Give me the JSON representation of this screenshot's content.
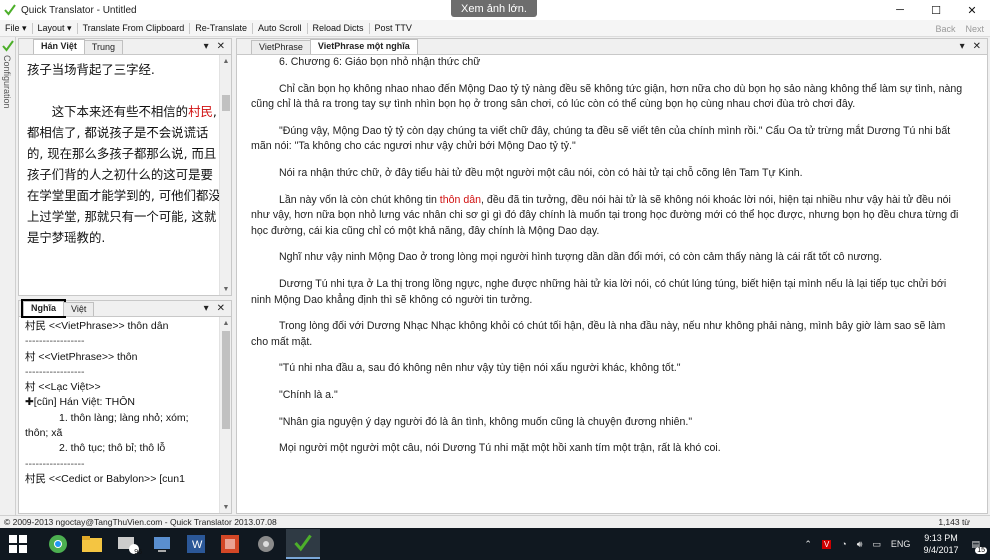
{
  "window": {
    "title": "Quick Translator - Untitled",
    "overlay_badge": "Xem ảnh lớn.",
    "controls": {
      "minimize": "─",
      "maximize": "☐",
      "close": "✕"
    }
  },
  "menu": {
    "items": [
      "File ▾",
      "Layout ▾",
      "Translate From Clipboard",
      "Re-Translate",
      "Auto Scroll",
      "Reload Dicts",
      "Post TTV"
    ],
    "back": "Back",
    "next": "Next"
  },
  "left_strip": {
    "label": "Configuration"
  },
  "chinese_panel": {
    "tabs": [
      "Hán Việt",
      "Trung"
    ],
    "paragraphs": [
      {
        "parts": [
          {
            "text": "孩子当场背起了三字经."
          }
        ]
      },
      {
        "parts": [
          {
            "text": "　　这下本来还有些不相信的"
          },
          {
            "text": "村民",
            "red": true
          },
          {
            "text": ", 都相信了, 都说孩子是不会说谎话的, 现在那么多孩子都那么说, 而且孩子们背的人之初什么的这可是要在学堂里面才能学到的, 可他们都没上过学堂, 那就只有一个可能, 这就是宁梦瑶教的."
          }
        ]
      }
    ]
  },
  "meaning_panel": {
    "tabs": [
      "Nghĩa",
      "Việt"
    ],
    "lines": [
      {
        "text": "村民 <<VietPhrase>> thôn dân"
      },
      {
        "text": "-----------------",
        "dash": true
      },
      {
        "text": "村 <<VietPhrase>> thôn"
      },
      {
        "text": "-----------------",
        "dash": true
      },
      {
        "text": "村 <<Lạc Việt>>"
      },
      {
        "text": "✚[cũn] Hán Việt: THÔN"
      },
      {
        "text": "1. thôn làng; làng nhỏ; xóm;",
        "indent": true
      },
      {
        "text": "thôn; xã"
      },
      {
        "text": "2. thô tục; thô bỉ; thô lỗ",
        "indent": true
      },
      {
        "text": "-----------------",
        "dash": true
      },
      {
        "text": "村民 <<Cedict or Babylon>>  [cun1"
      }
    ]
  },
  "vietphrase_panel": {
    "tabs": [
      "VietPhrase",
      "VietPhrase một nghĩa"
    ],
    "paragraphs": [
      {
        "parts": [
          {
            "text": "6. Chương 6: Giáo bọn nhỏ nhận thức chữ"
          }
        ]
      },
      {
        "parts": [
          {
            "text": "Chỉ cần bọn họ không nhao nhao đến Mộng Dao tỷ tỷ nàng đều sẽ không tức giận, hơn nữa cho dù bọn họ sảo nàng không thể làm sự tình, nàng cũng chỉ là thả ra trong tay sự tình nhìn bọn họ ở trong sân chơi, có lúc còn có thể cùng bọn họ cùng nhau chơi đùa trò chơi đây."
          }
        ]
      },
      {
        "parts": [
          {
            "text": "\"Đúng vậy, Mộng Dao tỷ tỷ còn dạy chúng ta viết chữ đây, chúng ta đều sẽ viết tên của chính mình rồi.\" Cẩu Oa tử trừng mắt Dương Tú nhi bất mãn nói: \"Ta không cho các ngươi như vậy chửi bới Mộng Dao tỷ tỷ.\""
          }
        ]
      },
      {
        "parts": [
          {
            "text": "Nói ra nhận thức chữ, ở đây tiểu hài tử đều một người một câu nói, còn có hài tử tại chỗ cõng lên Tam Tự Kinh."
          }
        ]
      },
      {
        "parts": [
          {
            "text": "Lần này vốn là còn chút không tin "
          },
          {
            "text": "thôn dân",
            "red": true
          },
          {
            "text": ", đều đã tin tưởng, đều nói hài tử là sẽ không nói khoác lời nói, hiện tại nhiều như vậy hài tử đều nói như vậy, hơn nữa bọn nhỏ lưng vác nhân chi sơ gì gì đó đây chính là muốn tại trong học đường mới có thể học được, nhưng bọn họ đều chưa từng đi học đường, cái kia cũng chỉ có một khả năng, đây chính là Mộng Dao dạy."
          }
        ]
      },
      {
        "parts": [
          {
            "text": "Nghĩ như vậy ninh Mộng Dao ở trong lòng mọi người hình tượng dần dần đổi mới, có còn cảm thấy nàng là cái rất tốt cô nương."
          }
        ]
      },
      {
        "parts": [
          {
            "text": "Dương Tú nhi tựa ở La thị trong lồng ngực, nghe được những hài tử kia lời nói, có chút lúng túng, biết hiện tại mình nếu là lại tiếp tục chửi bới ninh Mộng Dao khẳng định thì sẽ không có người tin tưởng."
          }
        ]
      },
      {
        "parts": [
          {
            "text": "Trong lòng đối với Dương Nhạc Nhạc không khỏi có chút tối hận, đều là nha đầu này, nếu như không phải nàng, mình bây giờ làm sao sẽ làm cho mất mặt."
          }
        ]
      },
      {
        "parts": [
          {
            "text": "\"Tú nhi nha đầu a, sau đó không nên như vậy tùy tiện nói xấu người khác, không tốt.\""
          }
        ]
      },
      {
        "parts": [
          {
            "text": "\"Chính là a.\""
          }
        ]
      },
      {
        "parts": [
          {
            "text": "\"Nhân gia nguyện ý dạy người đó là ân tình, không muốn cũng là chuyện đương nhiên.\""
          }
        ]
      },
      {
        "parts": [
          {
            "text": "Mọi người một người một câu, nói Dương Tú nhi mặt một hồi xanh tím một trận, rất là khó coi."
          }
        ]
      }
    ]
  },
  "statusbar": {
    "left": "© 2009-2013 ngoctay@TangThuVien.com - Quick Translator 2013.07.08",
    "right": "1,143 từ"
  },
  "taskbar": {
    "lang": "ENG",
    "time": "9:13 PM",
    "date": "9/4/2017",
    "notif_count": "15",
    "badge_96": "96"
  },
  "colors": {
    "red_text": "#d01010",
    "taskbar_bg": "#101820",
    "accent_green": "#4caf2a"
  }
}
